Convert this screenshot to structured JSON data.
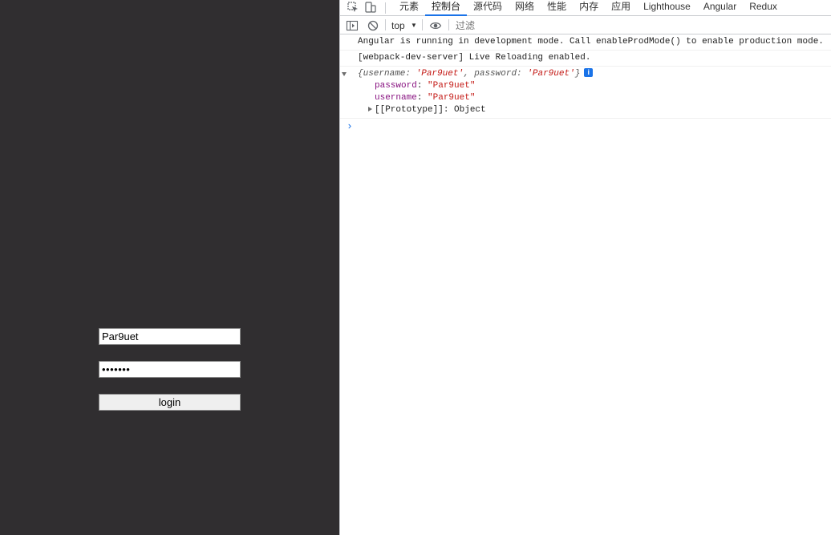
{
  "app": {
    "username_value": "Par9uet",
    "password_value": "Par9uet",
    "login_label": "login"
  },
  "devtools": {
    "tabs": [
      {
        "label": "元素",
        "active": false
      },
      {
        "label": "控制台",
        "active": true
      },
      {
        "label": "源代码",
        "active": false
      },
      {
        "label": "网络",
        "active": false
      },
      {
        "label": "性能",
        "active": false
      },
      {
        "label": "内存",
        "active": false
      },
      {
        "label": "应用",
        "active": false
      },
      {
        "label": "Lighthouse",
        "active": false
      },
      {
        "label": "Angular",
        "active": false
      },
      {
        "label": "Redux",
        "active": false
      }
    ],
    "toolbar": {
      "context": "top",
      "filter_placeholder": "过滤"
    },
    "console": {
      "messages": [
        "Angular is running in development mode. Call enableProdMode() to enable production mode.",
        "[webpack-dev-server] Live Reloading enabled."
      ],
      "object": {
        "preview_open": "{username: ",
        "preview_username": "'Par9uet'",
        "preview_mid": ", password: ",
        "preview_password": "'Par9uet'",
        "preview_close": "}",
        "info_badge": "i",
        "props": [
          {
            "key": "password",
            "value": "\"Par9uet\""
          },
          {
            "key": "username",
            "value": "\"Par9uet\""
          }
        ],
        "prototype": "[[Prototype]]: Object"
      },
      "prompt": "›"
    },
    "colors": {
      "accent": "#1a73e8",
      "string": "#c41a16",
      "property": "#881280",
      "app_background": "#302e30"
    }
  }
}
